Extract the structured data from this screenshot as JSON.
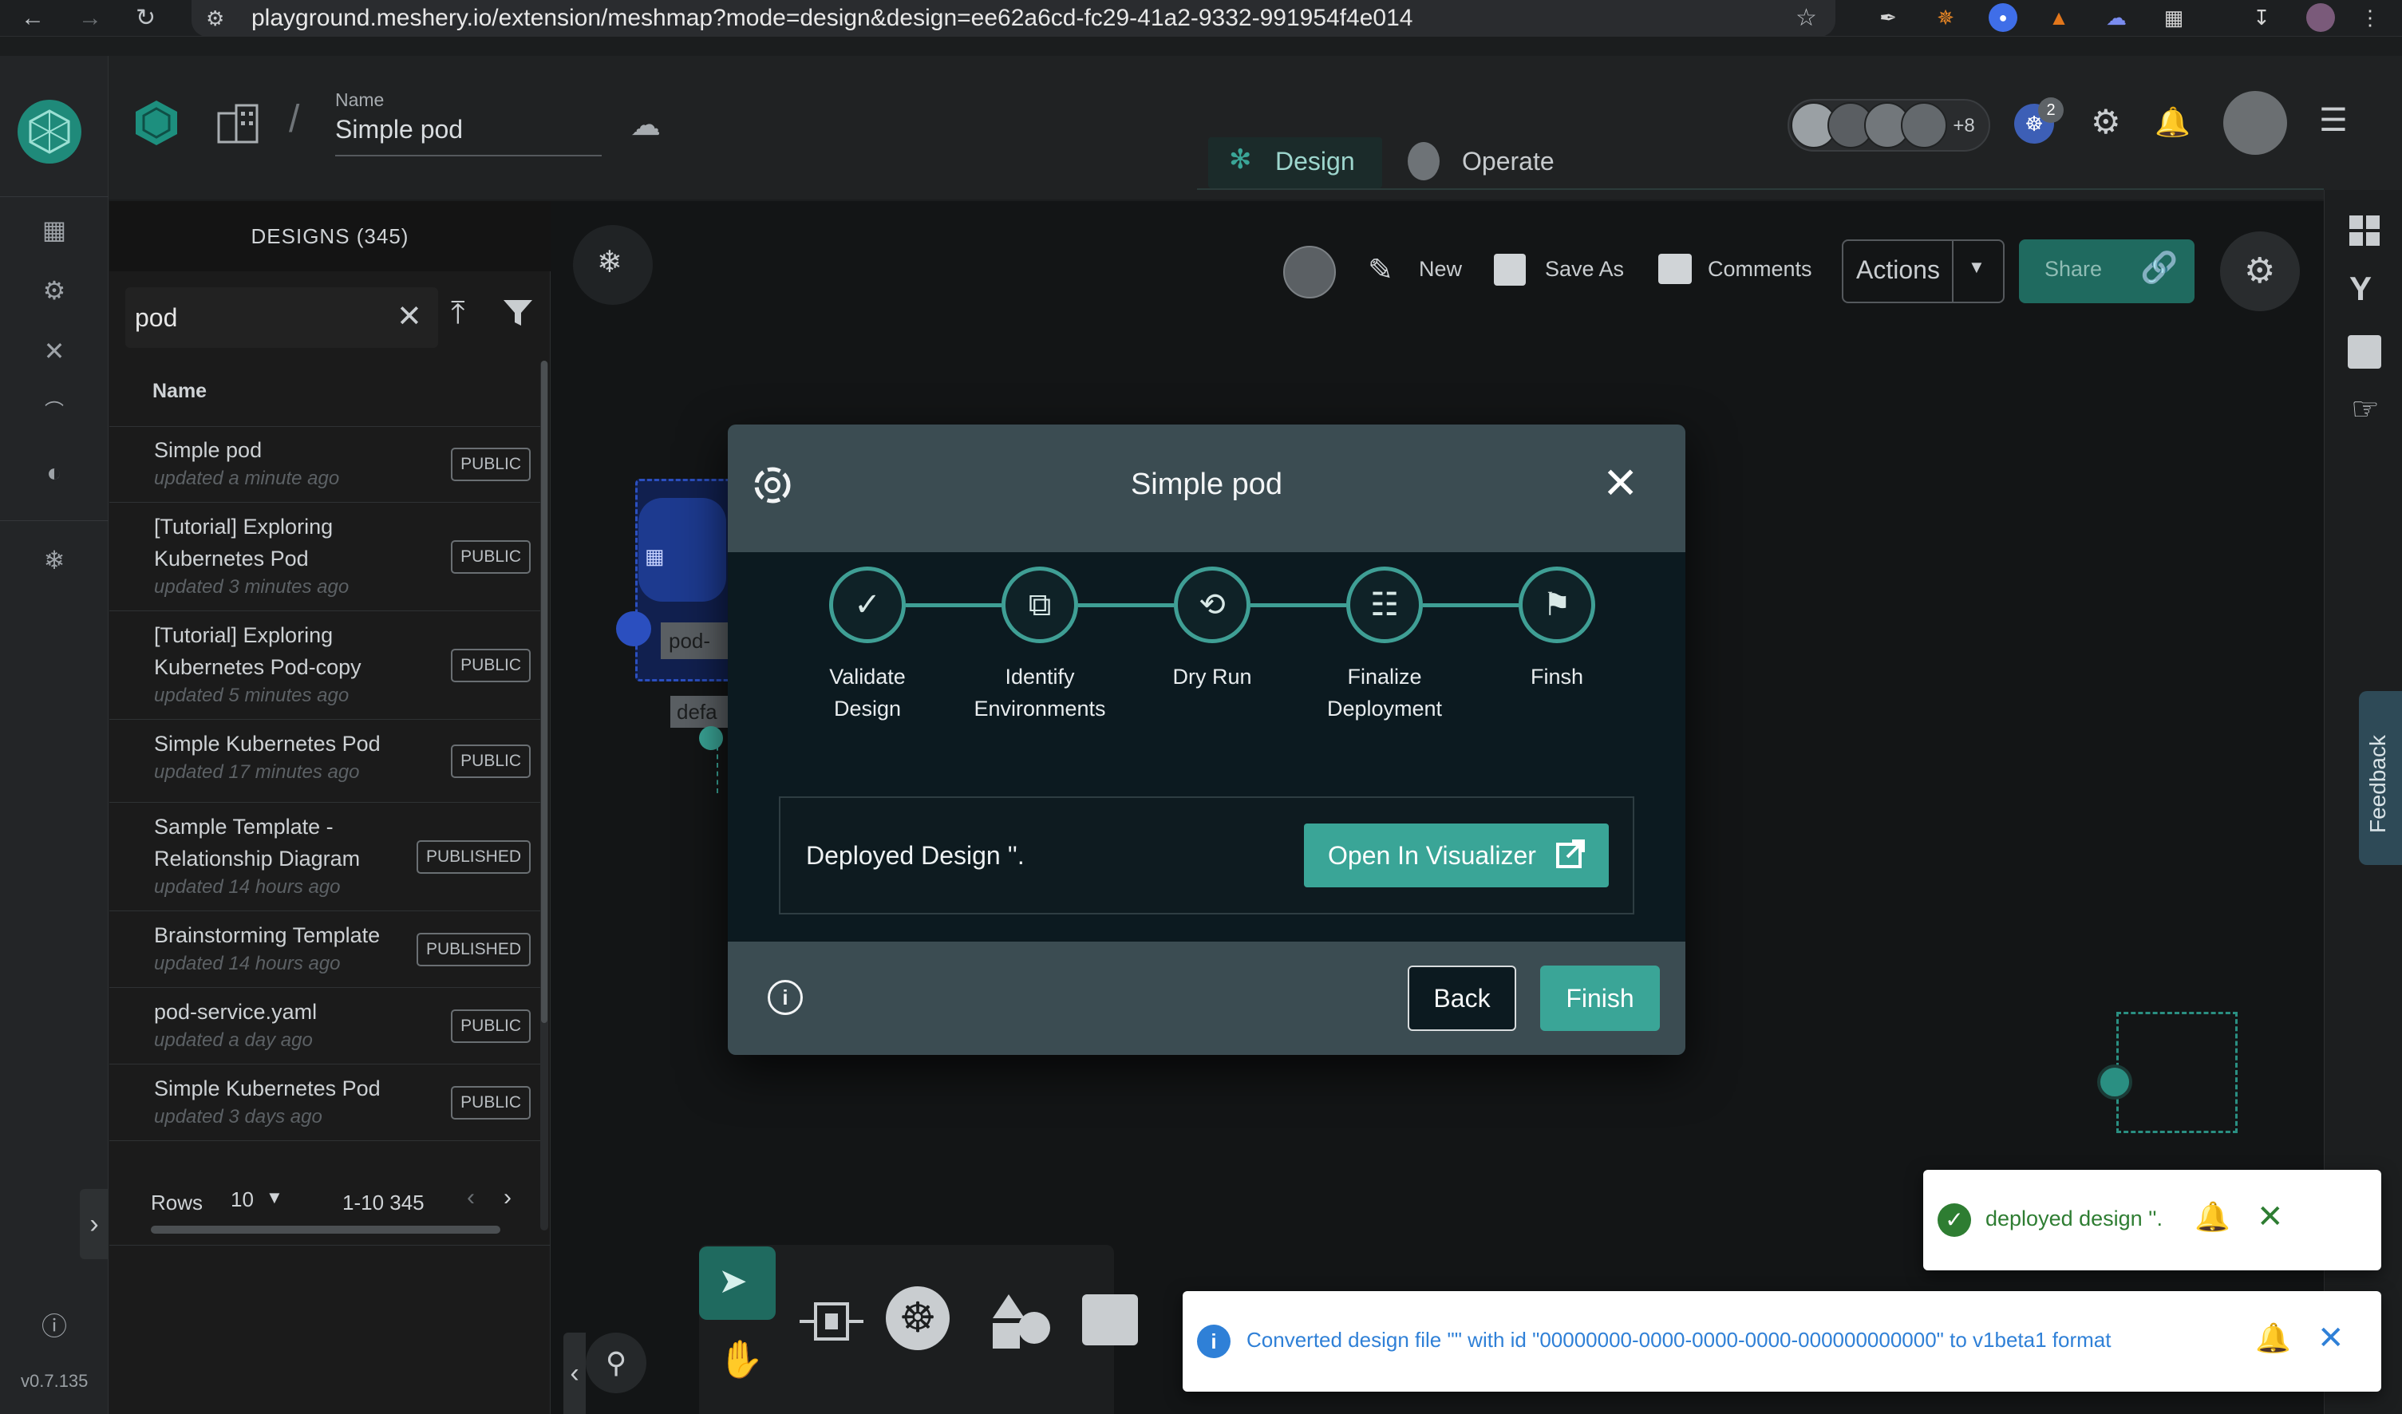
{
  "browser": {
    "url": "playground.meshery.io/extension/meshmap?mode=design&design=ee62a6cd-fc29-41a2-9332-991954f4e014"
  },
  "header": {
    "name_label": "Name",
    "design_name": "Simple pod",
    "tabs": [
      {
        "label": "Design"
      },
      {
        "label": "Operate"
      }
    ],
    "avatar_overflow": "+8",
    "notification_count": "2"
  },
  "toolbar": {
    "new_label": "New",
    "save_as_label": "Save As",
    "comments_label": "Comments",
    "actions_label": "Actions",
    "share_label": "Share"
  },
  "designs_panel": {
    "title": "DESIGNS (345)",
    "search_value": "pod",
    "column_name": "Name",
    "rows": [
      {
        "title_lines": [
          "Simple pod"
        ],
        "updated": "updated a minute ago",
        "badge": "PUBLIC"
      },
      {
        "title_lines": [
          "[Tutorial] Exploring",
          "Kubernetes Pod"
        ],
        "updated": "updated 3 minutes ago",
        "badge": "PUBLIC"
      },
      {
        "title_lines": [
          "[Tutorial] Exploring",
          "Kubernetes Pod-copy"
        ],
        "updated": "updated 5 minutes ago",
        "badge": "PUBLIC"
      },
      {
        "title_lines": [
          "Simple Kubernetes Pod"
        ],
        "updated": "updated 17 minutes ago",
        "badge": "PUBLIC"
      },
      {
        "title_lines": [
          "Sample Template -",
          "Relationship Diagram"
        ],
        "updated": "updated 14 hours ago",
        "badge": "PUBLISHED"
      },
      {
        "title_lines": [
          "Brainstorming Template"
        ],
        "updated": "updated 14 hours ago",
        "badge": "PUBLISHED"
      },
      {
        "title_lines": [
          "pod-service.yaml"
        ],
        "updated": "updated a day ago",
        "badge": "PUBLIC"
      },
      {
        "title_lines": [
          "Simple Kubernetes Pod"
        ],
        "updated": "updated 3 days ago",
        "badge": "PUBLIC"
      }
    ],
    "pagination": {
      "rows_label": "Rows",
      "rows_value": "10",
      "range": "1-10 345"
    }
  },
  "canvas": {
    "node_label": "pod-",
    "node_sub_label": "defa"
  },
  "dialog": {
    "title": "Simple pod",
    "steps": [
      {
        "label_lines": [
          "Validate",
          "Design"
        ],
        "icon": "check-icon"
      },
      {
        "label_lines": [
          "Identify",
          "Environments"
        ],
        "icon": "code-window-icon"
      },
      {
        "label_lines": [
          "Dry Run"
        ],
        "icon": "history-gear-icon"
      },
      {
        "label_lines": [
          "Finalize",
          "Deployment"
        ],
        "icon": "clipboard-gear-icon"
      },
      {
        "label_lines": [
          "Finsh"
        ],
        "icon": "checkered-flags-icon"
      }
    ],
    "message": "Deployed Design ''.",
    "open_visualizer_label": "Open In Visualizer",
    "back_label": "Back",
    "finish_label": "Finish"
  },
  "toasts": [
    {
      "text": "deployed design ''.",
      "type": "success"
    },
    {
      "text": "Converted design file \"\" with id \"00000000-0000-0000-0000-000000000000\" to v1beta1 format",
      "type": "info"
    }
  ],
  "feedback_tab": "Feedback",
  "version": "v0.7.135",
  "colors": {
    "accent": "#3aa597",
    "success": "#2e7d32",
    "info": "#2f80d7",
    "dialog_panel": "#3b4c52",
    "dialog_body": "#0c1a20"
  }
}
